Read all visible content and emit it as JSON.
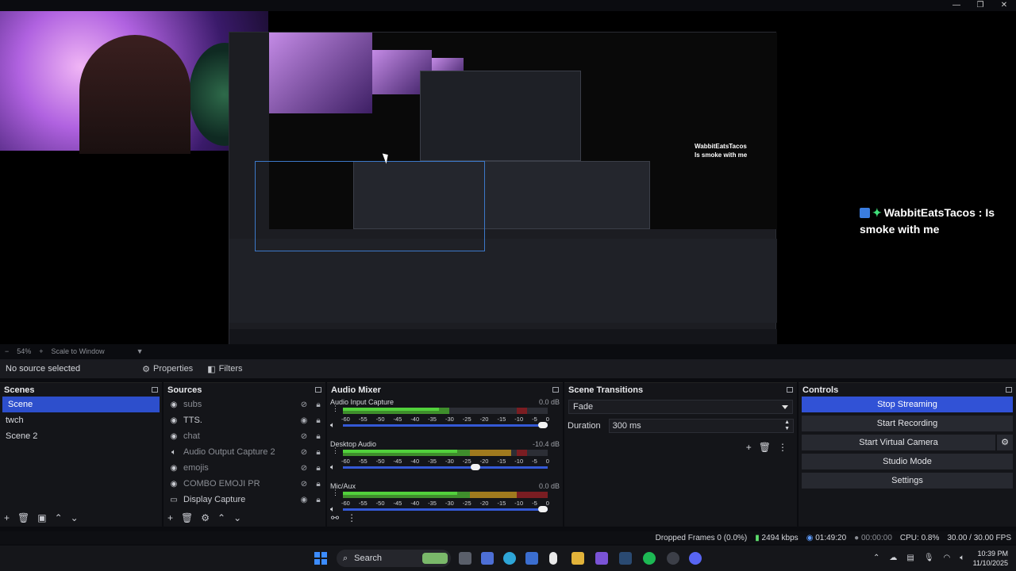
{
  "window": {
    "minimize": "—",
    "restore": "❐",
    "close": "✕"
  },
  "chat": {
    "username": "WabbitEatsTacos",
    "separator": ":",
    "message_first": "Is",
    "message_rest": "smoke with me"
  },
  "nested_chat": {
    "username": "WabbitEatsTacos",
    "message": "Is smoke with me"
  },
  "zoom": {
    "minus": "−",
    "value": "54%",
    "plus": "+",
    "mode": "Scale to Window"
  },
  "source_toolbar": {
    "no_source": "No source selected",
    "properties": "Properties",
    "filters": "Filters"
  },
  "scenes": {
    "title": "Scenes",
    "items": [
      {
        "label": "Scene",
        "selected": true
      },
      {
        "label": "twch",
        "selected": false
      },
      {
        "label": "Scene 2",
        "selected": false
      }
    ]
  },
  "sources": {
    "title": "Sources",
    "items": [
      {
        "label": "subs",
        "icon": "image-icon",
        "visible": false
      },
      {
        "label": "TTS.",
        "icon": "image-icon",
        "visible": true
      },
      {
        "label": "chat",
        "icon": "image-icon",
        "visible": false
      },
      {
        "label": "Audio Output Capture 2",
        "icon": "speaker-icon",
        "visible": false
      },
      {
        "label": "emojis",
        "icon": "image-icon",
        "visible": false
      },
      {
        "label": "COMBO EMOJI PR",
        "icon": "image-icon",
        "visible": false
      },
      {
        "label": "Display Capture",
        "icon": "monitor-icon",
        "visible": true
      }
    ]
  },
  "mixer": {
    "title": "Audio Mixer",
    "channels": [
      {
        "name": "Audio Input Capture",
        "db": "0.0 dB",
        "level": 0.52,
        "volume": 1.0
      },
      {
        "name": "Desktop Audio",
        "db": "-10.4 dB",
        "level": 0.82,
        "volume": 0.67
      },
      {
        "name": "Mic/Aux",
        "db": "0.0 dB",
        "level": 0.86,
        "volume": 1.0
      }
    ],
    "ticks": [
      "-60",
      "-55",
      "-50",
      "-45",
      "-40",
      "-35",
      "-30",
      "-25",
      "-20",
      "-15",
      "-10",
      "-5",
      "0"
    ]
  },
  "transitions": {
    "title": "Scene Transitions",
    "selected": "Fade",
    "duration_label": "Duration",
    "duration_value": "300 ms"
  },
  "controls": {
    "title": "Controls",
    "buttons": [
      "Stop Streaming",
      "Start Recording",
      "Start Virtual Camera",
      "Studio Mode",
      "Settings"
    ]
  },
  "status": {
    "dropped": "Dropped Frames 0 (0.0%)",
    "bitrate": "2494 kbps",
    "live_time": "01:49:20",
    "rec_time": "00:00:00",
    "cpu": "CPU: 0.8%",
    "fps": "30.00 / 30.00 FPS"
  },
  "taskbar": {
    "search": "Search",
    "time": "10:39 PM",
    "date": "11/10/2025"
  },
  "colors": {
    "accent": "#3152d6",
    "selected_scene": "#2d4fcc",
    "meter_green": "#52d13c",
    "chat_star": "#3fe07a"
  }
}
